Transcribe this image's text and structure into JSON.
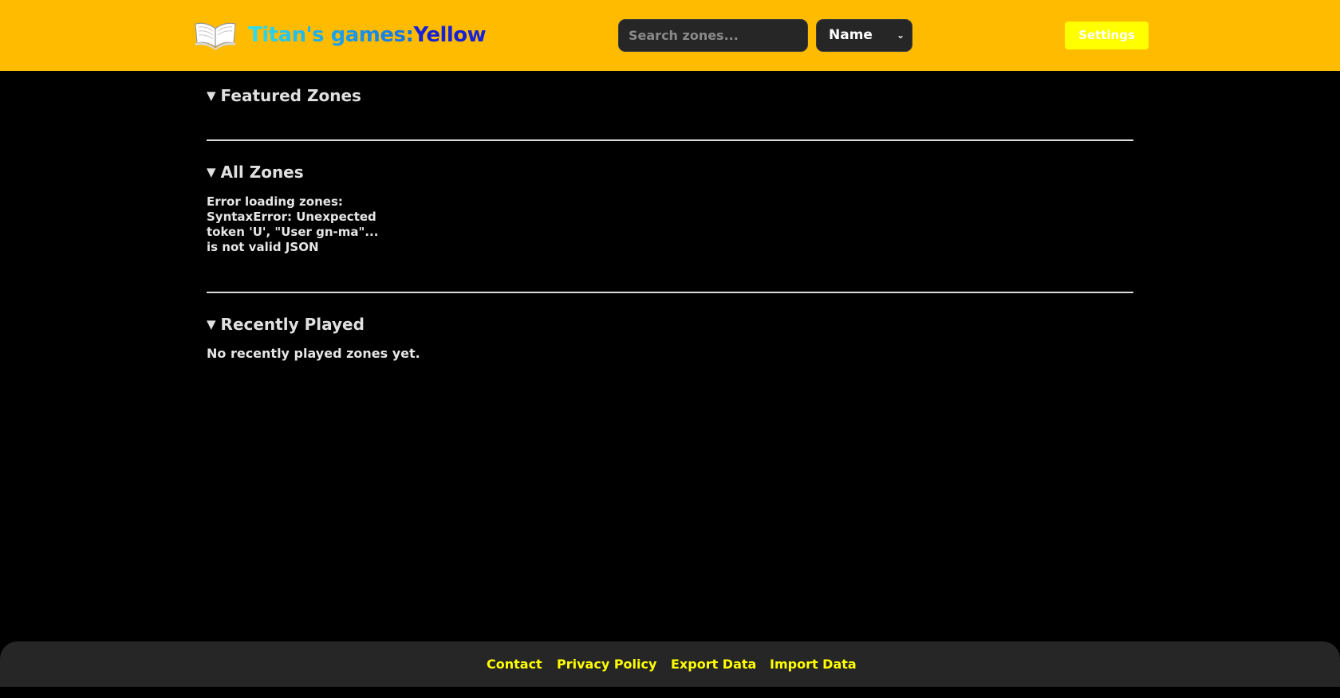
{
  "header": {
    "brand_part1": "Titan's games:",
    "brand_part2": "Yellow",
    "search_placeholder": "Search zones...",
    "sort_selected": "Name",
    "settings_label": "Settings",
    "logo_icon": "open-book-icon"
  },
  "main": {
    "featured": {
      "title": "Featured Zones"
    },
    "all_zones": {
      "title": "All Zones",
      "error_message": "Error loading zones: SyntaxError: Unexpected token 'U', \"User gn-ma\"... is not valid JSON"
    },
    "recent": {
      "title": "Recently Played",
      "empty_message": "No recently played zones yet."
    }
  },
  "footer": {
    "links": [
      "Contact",
      "Privacy Policy",
      "Export Data",
      "Import Data"
    ]
  },
  "colors": {
    "header_bg": "#ffbb00",
    "page_bg": "#000000",
    "footer_bg": "#262626",
    "accent_yellow": "#ffff00",
    "brand_blue": "#1722d6"
  }
}
